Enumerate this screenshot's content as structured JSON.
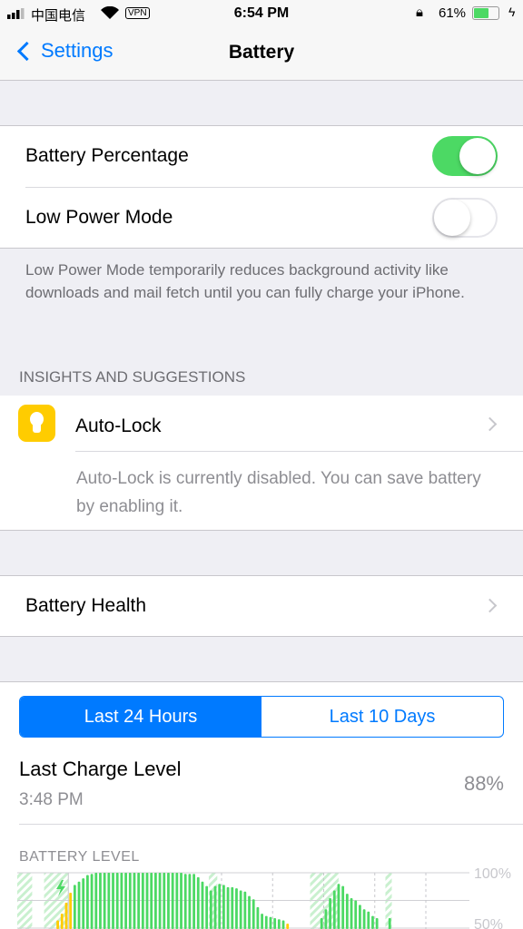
{
  "status_bar": {
    "carrier": "中国电信",
    "vpn": "VPN",
    "time": "6:54 PM",
    "battery": "61%",
    "battery_level": 61
  },
  "nav": {
    "back_label": "Settings",
    "title": "Battery"
  },
  "settings": {
    "battery_percentage": {
      "label": "Battery Percentage",
      "on": true
    },
    "low_power_mode": {
      "label": "Low Power Mode",
      "on": false
    },
    "low_power_footer": "Low Power Mode temporarily reduces background activity like downloads and mail fetch until you can fully charge your iPhone."
  },
  "insights": {
    "header": "INSIGHTS AND SUGGESTIONS",
    "title": "Auto-Lock",
    "icon": "lightbulb-icon",
    "description": "Auto-Lock is currently disabled. You can save battery by enabling it."
  },
  "battery_health": {
    "label": "Battery Health"
  },
  "usage": {
    "tabs": [
      {
        "label": "Last 24 Hours",
        "selected": true
      },
      {
        "label": "Last 10 Days",
        "selected": false
      }
    ],
    "last_charge": {
      "label": "Last Charge Level",
      "time": "3:48 PM",
      "value": "88%"
    },
    "battery_level_header": "BATTERY LEVEL"
  },
  "chart_data": {
    "type": "bar",
    "title": "BATTERY LEVEL",
    "y_ticks": [
      "100%",
      "50%"
    ],
    "ylim": [
      0,
      100
    ],
    "slots": 96,
    "colors": {
      "normal": "#4cd964",
      "low_power": "#ffcc00",
      "charging_hatch": "#c9f0cf"
    },
    "bars": [
      {
        "slot": 9,
        "v": 57,
        "c": "low_power"
      },
      {
        "slot": 10,
        "v": 63,
        "c": "low_power"
      },
      {
        "slot": 11,
        "v": 73,
        "c": "low_power"
      },
      {
        "slot": 12,
        "v": 82,
        "c": "low_power"
      },
      {
        "slot": 13,
        "v": 89
      },
      {
        "slot": 14,
        "v": 92
      },
      {
        "slot": 15,
        "v": 95
      },
      {
        "slot": 16,
        "v": 98
      },
      {
        "slot": 17,
        "v": 99
      },
      {
        "slot": 18,
        "v": 100
      },
      {
        "slot": 19,
        "v": 100
      },
      {
        "slot": 20,
        "v": 100
      },
      {
        "slot": 21,
        "v": 100
      },
      {
        "slot": 22,
        "v": 100
      },
      {
        "slot": 23,
        "v": 100
      },
      {
        "slot": 24,
        "v": 100
      },
      {
        "slot": 25,
        "v": 100
      },
      {
        "slot": 26,
        "v": 100
      },
      {
        "slot": 27,
        "v": 100
      },
      {
        "slot": 28,
        "v": 100
      },
      {
        "slot": 29,
        "v": 100
      },
      {
        "slot": 30,
        "v": 100
      },
      {
        "slot": 31,
        "v": 100
      },
      {
        "slot": 32,
        "v": 100
      },
      {
        "slot": 33,
        "v": 100
      },
      {
        "slot": 34,
        "v": 100
      },
      {
        "slot": 35,
        "v": 100
      },
      {
        "slot": 36,
        "v": 100
      },
      {
        "slot": 37,
        "v": 100
      },
      {
        "slot": 38,
        "v": 100
      },
      {
        "slot": 39,
        "v": 99
      },
      {
        "slot": 40,
        "v": 99
      },
      {
        "slot": 41,
        "v": 99
      },
      {
        "slot": 42,
        "v": 96
      },
      {
        "slot": 43,
        "v": 92
      },
      {
        "slot": 44,
        "v": 88
      },
      {
        "slot": 45,
        "v": 84
      },
      {
        "slot": 46,
        "v": 88
      },
      {
        "slot": 47,
        "v": 90
      },
      {
        "slot": 48,
        "v": 89
      },
      {
        "slot": 49,
        "v": 87
      },
      {
        "slot": 50,
        "v": 87
      },
      {
        "slot": 51,
        "v": 86
      },
      {
        "slot": 52,
        "v": 84
      },
      {
        "slot": 53,
        "v": 83
      },
      {
        "slot": 54,
        "v": 79
      },
      {
        "slot": 55,
        "v": 76
      },
      {
        "slot": 56,
        "v": 69
      },
      {
        "slot": 57,
        "v": 63
      },
      {
        "slot": 58,
        "v": 61
      },
      {
        "slot": 59,
        "v": 60
      },
      {
        "slot": 60,
        "v": 59
      },
      {
        "slot": 61,
        "v": 58
      },
      {
        "slot": 62,
        "v": 57
      },
      {
        "slot": 63,
        "v": 54,
        "c": "low_power"
      },
      {
        "slot": 71,
        "v": 59
      },
      {
        "slot": 72,
        "v": 67
      },
      {
        "slot": 73,
        "v": 77
      },
      {
        "slot": 74,
        "v": 84
      },
      {
        "slot": 75,
        "v": 90
      },
      {
        "slot": 76,
        "v": 88
      },
      {
        "slot": 77,
        "v": 81
      },
      {
        "slot": 78,
        "v": 77
      },
      {
        "slot": 79,
        "v": 75
      },
      {
        "slot": 80,
        "v": 71
      },
      {
        "slot": 81,
        "v": 67
      },
      {
        "slot": 82,
        "v": 65
      },
      {
        "slot": 83,
        "v": 61
      },
      {
        "slot": 84,
        "v": 59
      },
      {
        "slot": 87,
        "v": 59
      }
    ],
    "charging_periods": [
      [
        0,
        3.5
      ],
      [
        6.3,
        12
      ],
      [
        45,
        47
      ],
      [
        68.8,
        75.5
      ],
      [
        86.5,
        88
      ]
    ],
    "grid": true
  }
}
